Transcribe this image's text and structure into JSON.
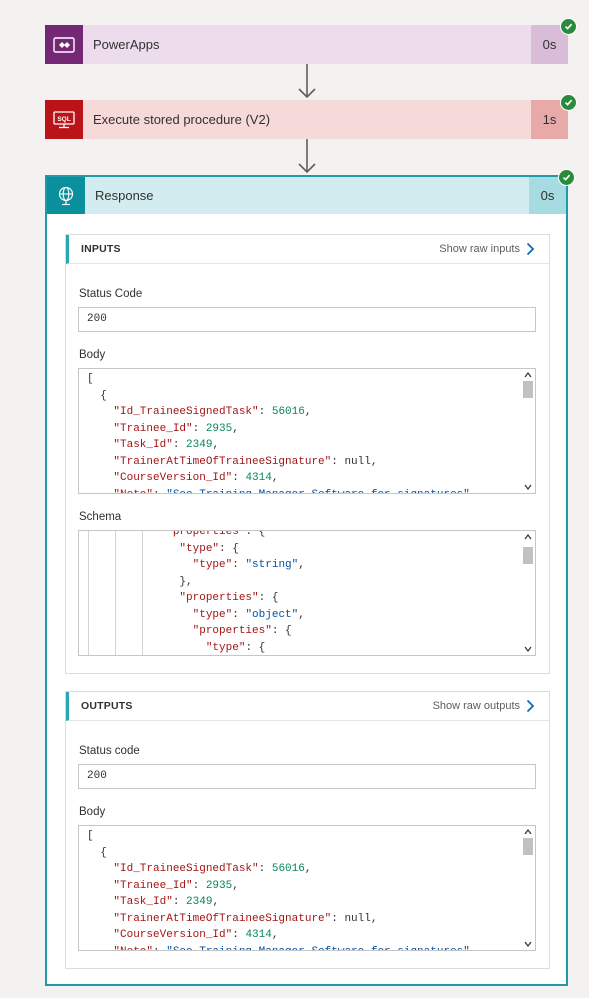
{
  "steps": [
    {
      "title": "PowerApps",
      "duration": "0s",
      "color": "#742774",
      "bg": "#ecdcec",
      "dur_bg": "#d8bcd8"
    },
    {
      "title": "Execute stored procedure (V2)",
      "duration": "1s",
      "color": "#ba141a",
      "bg": "#f6d9d9",
      "dur_bg": "#e8a9a9"
    }
  ],
  "response": {
    "title": "Response",
    "duration": "0s",
    "inputs": {
      "header": "INPUTS",
      "raw_link": "Show raw inputs",
      "status_label": "Status Code",
      "status_value": "200",
      "body_label": "Body",
      "schema_label": "Schema"
    },
    "outputs": {
      "header": "OUTPUTS",
      "raw_link": "Show raw outputs",
      "status_label": "Status code",
      "status_value": "200",
      "body_label": "Body"
    }
  },
  "body_code": [
    {
      "t": "[",
      "k": "",
      "v": "",
      "vt": ""
    },
    {
      "t": "  {",
      "k": "",
      "v": "",
      "vt": ""
    },
    {
      "t": "    ",
      "k": "\"Id_TraineeSignedTask\"",
      "v": "56016",
      "vt": "n"
    },
    {
      "t": "    ",
      "k": "\"Trainee_Id\"",
      "v": "2935",
      "vt": "n"
    },
    {
      "t": "    ",
      "k": "\"Task_Id\"",
      "v": "2349",
      "vt": "n"
    },
    {
      "t": "    ",
      "k": "\"TrainerAtTimeOfTraineeSignature\"",
      "v": "null",
      "vt": ""
    },
    {
      "t": "    ",
      "k": "\"CourseVersion_Id\"",
      "v": "4314",
      "vt": "n"
    },
    {
      "t": "    ",
      "k": "\"Note\"",
      "v": "\"See Training Manager Software for signatures\"",
      "vt": "s"
    }
  ],
  "schema_code": [
    {
      "t": "            ",
      "k": "\"properties\"",
      "v": "{",
      "vt": "p"
    },
    {
      "t": "              ",
      "k": "\"type\"",
      "v": "{",
      "vt": "p"
    },
    {
      "t": "                ",
      "k": "\"type\"",
      "v": "\"string\"",
      "vt": "s"
    },
    {
      "t": "              },",
      "k": "",
      "v": "",
      "vt": ""
    },
    {
      "t": "              ",
      "k": "\"properties\"",
      "v": "{",
      "vt": "p"
    },
    {
      "t": "                ",
      "k": "\"type\"",
      "v": "\"object\"",
      "vt": "s"
    },
    {
      "t": "                ",
      "k": "\"properties\"",
      "v": "{",
      "vt": "p"
    },
    {
      "t": "                  ",
      "k": "\"type\"",
      "v": "{",
      "vt": "p"
    }
  ]
}
